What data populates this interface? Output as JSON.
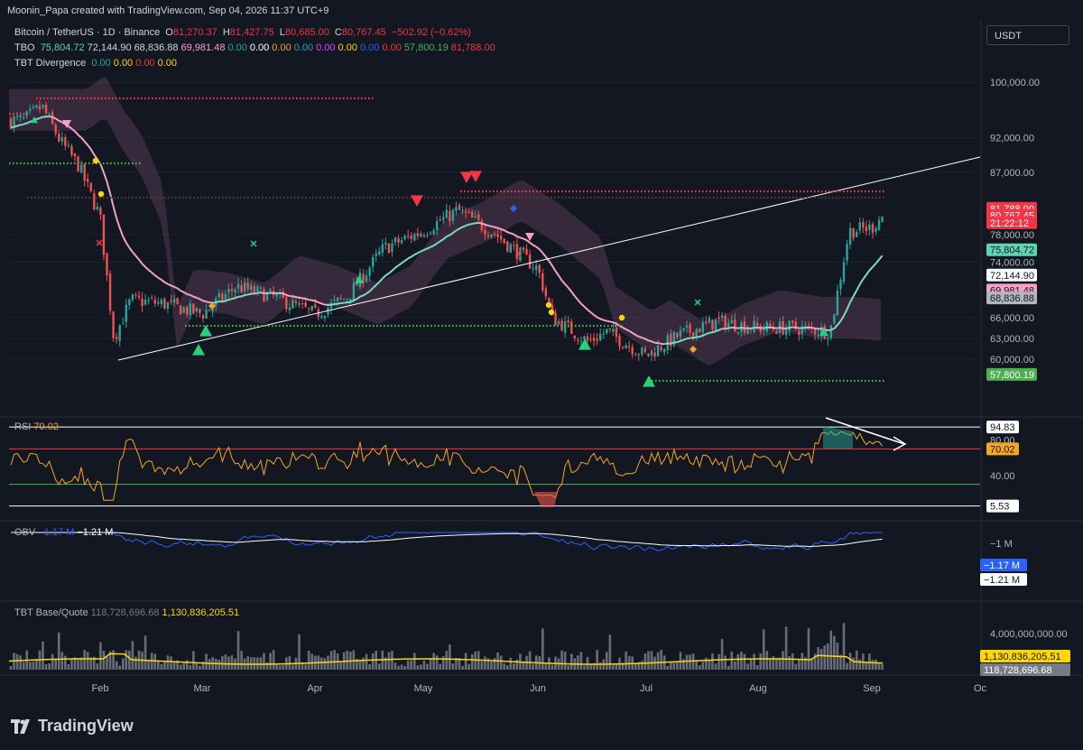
{
  "header": {
    "credit": "Moonin_Papa created with TradingView.com, Sep 04, 2026 11:37 UTC+9"
  },
  "currency_button": "USDT",
  "logo_text": "TradingView",
  "legend_main": {
    "symbol": "Bitcoin / TetherUS · 1D · Binance",
    "o_label": "O",
    "o": "81,270.37",
    "h_label": "H",
    "h": "81,427.75",
    "l_label": "L",
    "l": "80,685.00",
    "c_label": "C",
    "c": "80,767.45",
    "change": "−502.92 (−0.62%)"
  },
  "legend_tbo": {
    "name": "TBO",
    "values": [
      {
        "v": "75,804.72",
        "color": "#5fd3b3"
      },
      {
        "v": "72,144.90",
        "color": "#d1d4dc"
      },
      {
        "v": "68,836.88",
        "color": "#d1d4dc"
      },
      {
        "v": "69,981.48",
        "color": "#f7a1c4"
      },
      {
        "v": "0.00",
        "color": "#26a69a"
      },
      {
        "v": "0.00",
        "color": "#ffffff"
      },
      {
        "v": "0.00",
        "color": "#f5a623"
      },
      {
        "v": "0.00",
        "color": "#26a69a"
      },
      {
        "v": "0.00",
        "color": "#e040fb"
      },
      {
        "v": "0.00",
        "color": "#ffd600"
      },
      {
        "v": "0.00",
        "color": "#2962ff"
      },
      {
        "v": "0.00",
        "color": "#f23645"
      },
      {
        "v": "57,800.19",
        "color": "#4caf50"
      },
      {
        "v": "81,788.00",
        "color": "#f23645"
      }
    ]
  },
  "legend_div": {
    "name": "TBT Divergence",
    "values": [
      {
        "v": "0.00",
        "color": "#26a69a"
      },
      {
        "v": "0.00",
        "color": "#ffd600"
      },
      {
        "v": "0.00",
        "color": "#f23645"
      },
      {
        "v": "0.00",
        "color": "#ffd600"
      }
    ]
  },
  "panes": {
    "rsi_title": "RSI",
    "rsi_value": "70.02",
    "obv_title": "OBV",
    "obv_v1": "−1.17 M",
    "obv_v2": "−1.21 M",
    "vol_title": "TBT Base/Quote",
    "vol_v1": "118,728,696.68",
    "vol_v2": "1,130,836,205.51"
  },
  "price_axis": {
    "ticks": [
      100000,
      92000,
      87000,
      78000,
      74000,
      66000,
      63000,
      60000
    ],
    "labels": [
      "100,000.00",
      "92,000.00",
      "87,000.00",
      "78,000.00",
      "74,000.00",
      "66,000.00",
      "63,000.00",
      "60,000.00"
    ],
    "tags": [
      {
        "text": "81,788.00",
        "bg": "#f23645",
        "fg": "#ffffff",
        "price": 81788
      },
      {
        "text": "80,767.45",
        "bg": "#f23645",
        "fg": "#ffffff",
        "price": 80767.45
      },
      {
        "text": "21:22:12",
        "bg": "#f23645",
        "fg": "#ffffff",
        "price": 79700
      },
      {
        "text": "75,804.72",
        "bg": "#5fd3b3",
        "fg": "#131722",
        "price": 75804.72
      },
      {
        "text": "72,144.90",
        "bg": "#ffffff",
        "fg": "#131722",
        "price": 72144.9
      },
      {
        "text": "69,981.48",
        "bg": "#f7a1c4",
        "fg": "#131722",
        "price": 69981.48
      },
      {
        "text": "68,836.88",
        "bg": "#b2b5be",
        "fg": "#131722",
        "price": 68836.88
      },
      {
        "text": "57,800.19",
        "bg": "#4caf50",
        "fg": "#ffffff",
        "price": 57800.19
      }
    ]
  },
  "rsi_axis": {
    "ticks": [
      80,
      40
    ],
    "labels": [
      "80.00",
      "40.00"
    ],
    "tags": [
      {
        "text": "94.83",
        "bg": "#ffffff",
        "fg": "#131722",
        "v": 94.83
      },
      {
        "text": "70.02",
        "bg": "#f5a623",
        "fg": "#131722",
        "v": 70.02
      },
      {
        "text": "5.53",
        "bg": "#ffffff",
        "fg": "#131722",
        "v": 5.53
      }
    ]
  },
  "obv_axis": {
    "labels": [
      "−1 M"
    ],
    "tags": [
      {
        "text": "−1.17 M",
        "bg": "#2962ff",
        "fg": "#ffffff"
      },
      {
        "text": "−1.21 M",
        "bg": "#ffffff",
        "fg": "#131722"
      }
    ]
  },
  "vol_axis": {
    "labels": [
      "4,000,000,000.00"
    ],
    "tags": [
      {
        "text": "1,130,836,205.51",
        "bg": "#ffd600",
        "fg": "#131722"
      },
      {
        "text": "118,728,696.68",
        "bg": "#787b86",
        "fg": "#ffffff"
      }
    ]
  },
  "time_axis": {
    "labels": [
      "Feb",
      "Mar",
      "Apr",
      "May",
      "Jun",
      "Jul",
      "Aug",
      "Sep",
      "Oc"
    ]
  },
  "colors": {
    "up": "#26a69a",
    "down": "#ef5350",
    "bg": "#131722",
    "grid": "#1e222d",
    "rsi": "#f5a623",
    "obv": "#2962ff",
    "obv_ma": "#ffffff",
    "vol_ma": "#ffd600"
  },
  "chart_data": [
    {
      "type": "candlestick",
      "title": "Bitcoin / TetherUS · 1D · Binance",
      "ylim": [
        57000,
        104000
      ],
      "x": [
        "Feb",
        "Mar",
        "Apr",
        "May",
        "Jun",
        "Jul",
        "Aug",
        "Sep"
      ],
      "close_path": [
        [
          "Jan 10",
          94500
        ],
        [
          "Jan 15",
          96500
        ],
        [
          "Jan 20",
          91500
        ],
        [
          "Jan 25",
          88000
        ],
        [
          "Feb 1",
          80500
        ],
        [
          "Feb 5",
          63000
        ],
        [
          "Feb 10",
          68500
        ],
        [
          "Feb 20",
          68000
        ],
        [
          "Mar 1",
          66500
        ],
        [
          "Mar 10",
          70500
        ],
        [
          "Mar 20",
          69000
        ],
        [
          "Apr 1",
          66500
        ],
        [
          "Apr 10",
          69000
        ],
        [
          "Apr 20",
          76000
        ],
        [
          "May 1",
          78500
        ],
        [
          "May 10",
          81500
        ],
        [
          "May 20",
          78000
        ],
        [
          "Jun 1",
          73000
        ],
        [
          "Jun 5",
          66000
        ],
        [
          "Jun 15",
          62500
        ],
        [
          "Jun 20",
          64000
        ],
        [
          "Jul 1",
          60500
        ],
        [
          "Jul 10",
          63500
        ],
        [
          "Jul 20",
          65500
        ],
        [
          "Aug 1",
          64500
        ],
        [
          "Aug 10",
          64500
        ],
        [
          "Aug 20",
          64000
        ],
        [
          "Aug 25",
          78500
        ],
        [
          "Sep 1",
          79000
        ],
        [
          "Sep 4",
          80767.45
        ]
      ],
      "levels": {
        "resistance": 81788.0,
        "support": 57800.19
      },
      "tbo": {
        "fast": 75804.72,
        "mid": 72144.9,
        "slow": 68836.88,
        "pink": 69981.48
      }
    },
    {
      "type": "line",
      "title": "RSI",
      "ylim": [
        0,
        100
      ],
      "levels": [
        94.83,
        70.02,
        5.53
      ],
      "last": 70.02
    },
    {
      "type": "line",
      "title": "OBV",
      "series": [
        {
          "name": "OBV",
          "last": -1.17
        },
        {
          "name": "MA",
          "last": -1.21
        }
      ]
    },
    {
      "type": "bar",
      "title": "TBT Base/Quote",
      "series": [
        {
          "name": "volume",
          "last": 118728696.68
        },
        {
          "name": "MA",
          "last": 1130836205.51
        }
      ]
    }
  ]
}
